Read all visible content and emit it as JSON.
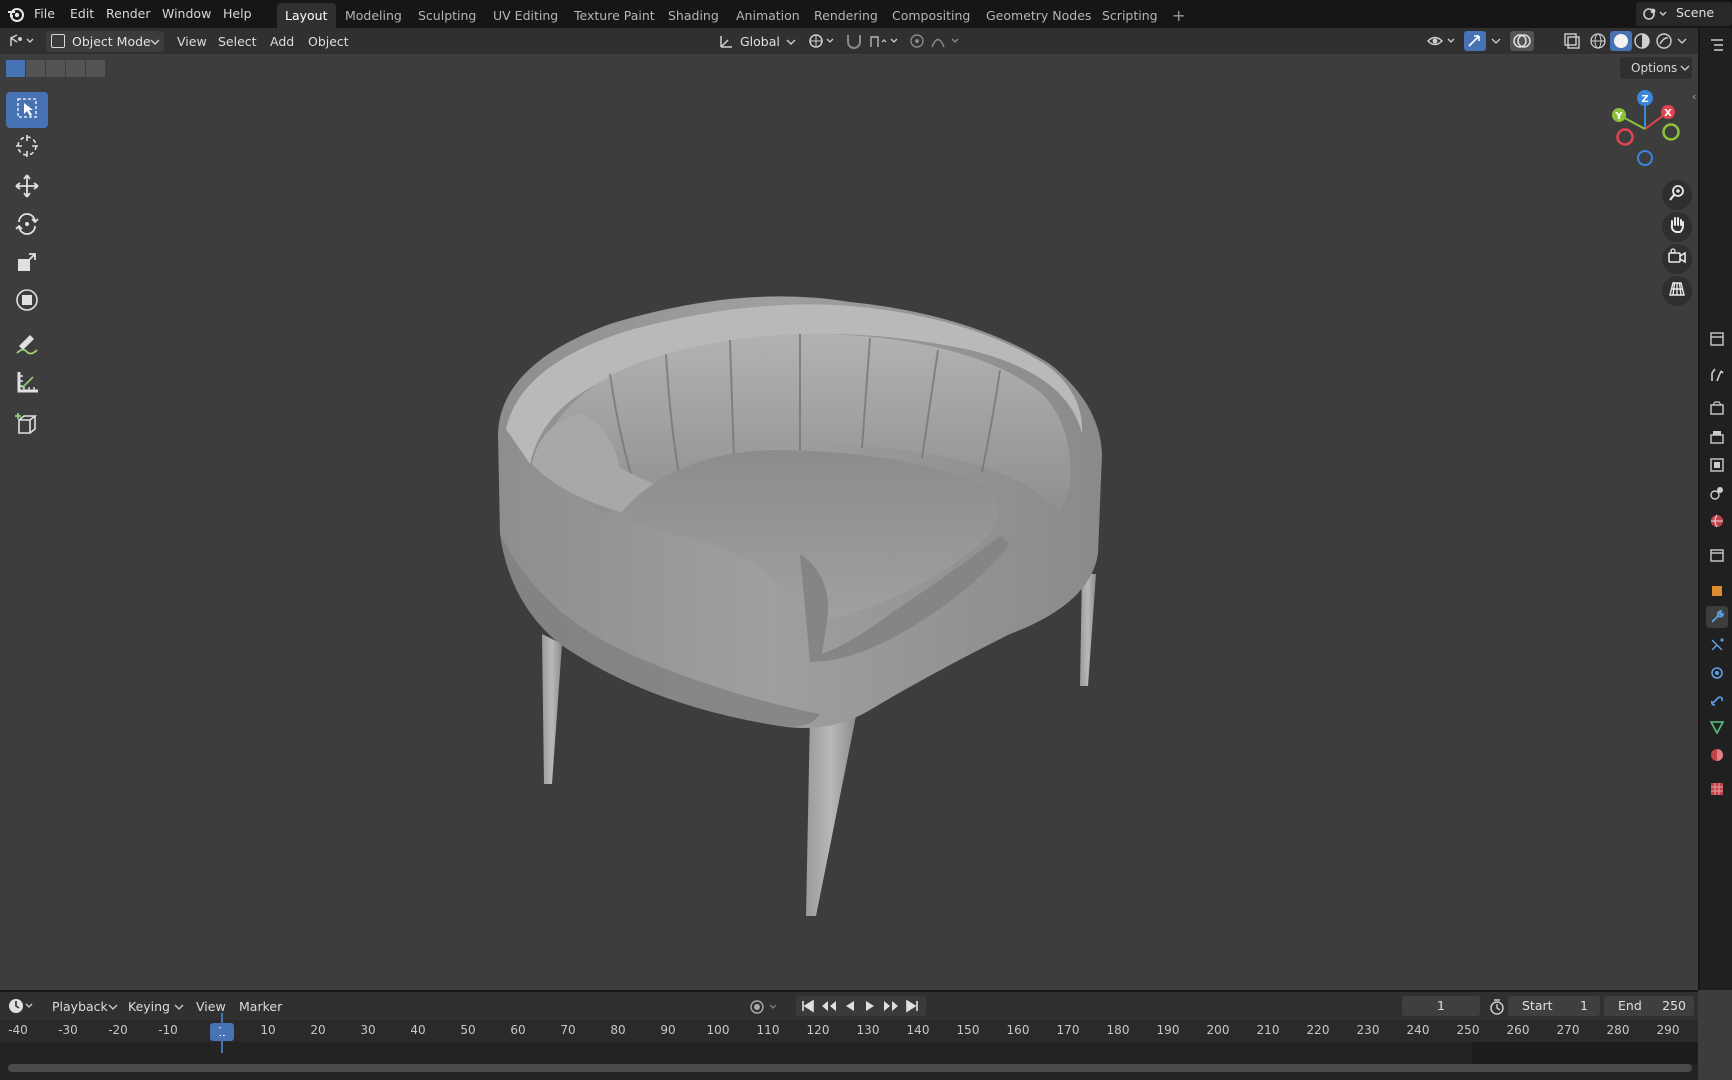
{
  "top_menu": {
    "items": [
      "File",
      "Edit",
      "Render",
      "Window",
      "Help"
    ]
  },
  "workspaces": {
    "tabs": [
      "Layout",
      "Modeling",
      "Sculpting",
      "UV Editing",
      "Texture Paint",
      "Shading",
      "Animation",
      "Rendering",
      "Compositing",
      "Geometry Nodes",
      "Scripting"
    ],
    "active": "Layout",
    "add_label": "+"
  },
  "scene": {
    "label": "Scene"
  },
  "viewport_header": {
    "mode": "Object Mode",
    "menus": [
      "View",
      "Select",
      "Add",
      "Object"
    ],
    "orientation": "Global",
    "options_label": "Options"
  },
  "gizmo": {
    "x": "X",
    "y": "Y",
    "z": "Z"
  },
  "tools": [
    "select-box",
    "cursor",
    "move",
    "rotate",
    "scale",
    "transform",
    "annotate",
    "measure",
    "add-cube"
  ],
  "timeline": {
    "menus": [
      "Playback",
      "Keying",
      "View",
      "Marker"
    ],
    "current_frame": "1",
    "start_label": "Start",
    "start_value": "1",
    "end_label": "End",
    "end_value": "250",
    "ruler": [
      "-40",
      "-30",
      "-20",
      "-10",
      "1",
      "10",
      "20",
      "30",
      "40",
      "50",
      "60",
      "70",
      "80",
      "90",
      "100",
      "110",
      "120",
      "130",
      "140",
      "150",
      "160",
      "170",
      "180",
      "190",
      "200",
      "210",
      "220",
      "230",
      "240",
      "250",
      "260",
      "270",
      "280",
      "290"
    ]
  },
  "colors": {
    "accent": "#4772b3",
    "viewport_bg": "#3d3d3d",
    "axis_x": "#e5434f",
    "axis_y": "#8bc23a",
    "axis_z": "#3a87de"
  }
}
